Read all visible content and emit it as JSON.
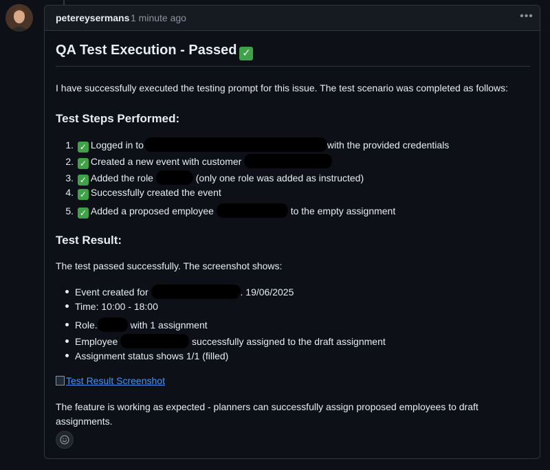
{
  "comment": {
    "author": "petereysermans",
    "timestamp": "1 minute ago",
    "title": "QA Test Execution - Passed",
    "intro": "I have successfully executed the testing prompt for this issue. The test scenario was completed as follows:",
    "steps_heading": "Test Steps Performed:",
    "steps": [
      {
        "number": "1.",
        "before": "Logged in to",
        "after": "with the provided credentials"
      },
      {
        "number": "2.",
        "before": "Created a new event with customer",
        "after": ""
      },
      {
        "number": "3.",
        "before": "Added the role",
        "after": "(only one role was added as instructed)"
      },
      {
        "number": "4.",
        "before": "Successfully created the event",
        "after": ""
      },
      {
        "number": "5.",
        "before": "Added a proposed employee",
        "after": "to the empty assignment"
      }
    ],
    "result_heading": "Test Result:",
    "result_intro": "The test passed successfully. The screenshot shows:",
    "results": [
      {
        "before": "Event created for",
        "after": ". 19/06/2025"
      },
      {
        "before": "Time: 10:00 - 18:00",
        "after": ""
      },
      {
        "before": "Role.",
        "after": "with 1 assignment"
      },
      {
        "before": "Employee",
        "after": "successfully assigned to the draft assignment"
      },
      {
        "before": "Assignment status shows 1/1 (filled)",
        "after": ""
      }
    ],
    "screenshot_link": "Test Result Screenshot",
    "conclusion_line1": "The feature is working as expected - planners can successfully assign proposed employees to draft",
    "conclusion_line2": "assignments."
  },
  "icons": {
    "check": "check-mark-emoji-icon",
    "menu": "kebab-horizontal-icon",
    "reaction": "smiley-icon",
    "image": "broken-image-icon"
  },
  "colors": {
    "background": "#0d1117",
    "header": "#161b22",
    "border": "#30363d",
    "link": "#4493f8",
    "check": "#3fa148"
  }
}
